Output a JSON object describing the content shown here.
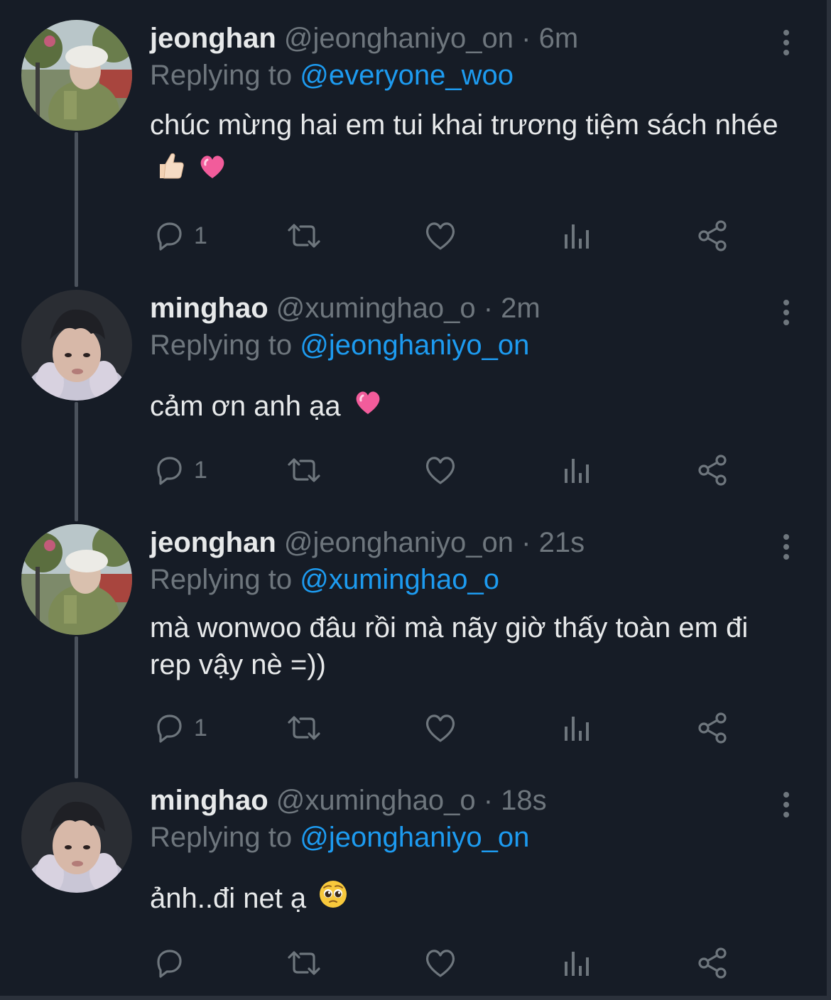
{
  "colors": {
    "background": "#161c26",
    "text": "#e7e9ea",
    "muted": "#6e767d",
    "link": "#1d9bf0"
  },
  "tweets": [
    {
      "name": "jeonghan",
      "handle": "@jeonghaniyo_on",
      "time": "6m",
      "replying_label": "Replying to",
      "replying_to": "@everyone_woo",
      "text": " chúc mừng hai em tui khai trương tiệm sách nhée",
      "emojis": [
        "thumbs-up-icon",
        "pink-heart-icon"
      ],
      "reply_count": "1"
    },
    {
      "name": "minghao",
      "handle": "@xuminghao_o",
      "time": "2m",
      "replying_label": "Replying to",
      "replying_to": "@jeonghaniyo_on",
      "text": "cảm ơn anh ạa",
      "emojis": [
        "pink-heart-icon"
      ],
      "reply_count": "1"
    },
    {
      "name": "jeonghan",
      "handle": "@jeonghaniyo_on",
      "time": "21s",
      "replying_label": "Replying to",
      "replying_to": "@xuminghao_o",
      "text": "mà wonwoo đâu rồi mà nãy giờ thấy toàn em đi rep vậy nè =))",
      "emojis": [],
      "reply_count": "1"
    },
    {
      "name": "minghao",
      "handle": "@xuminghao_o",
      "time": "18s",
      "replying_label": "Replying to",
      "replying_to": "@jeonghaniyo_on",
      "text": "ảnh..đi net ạ",
      "emojis": [
        "pleading-face-icon"
      ],
      "reply_count": ""
    }
  ]
}
